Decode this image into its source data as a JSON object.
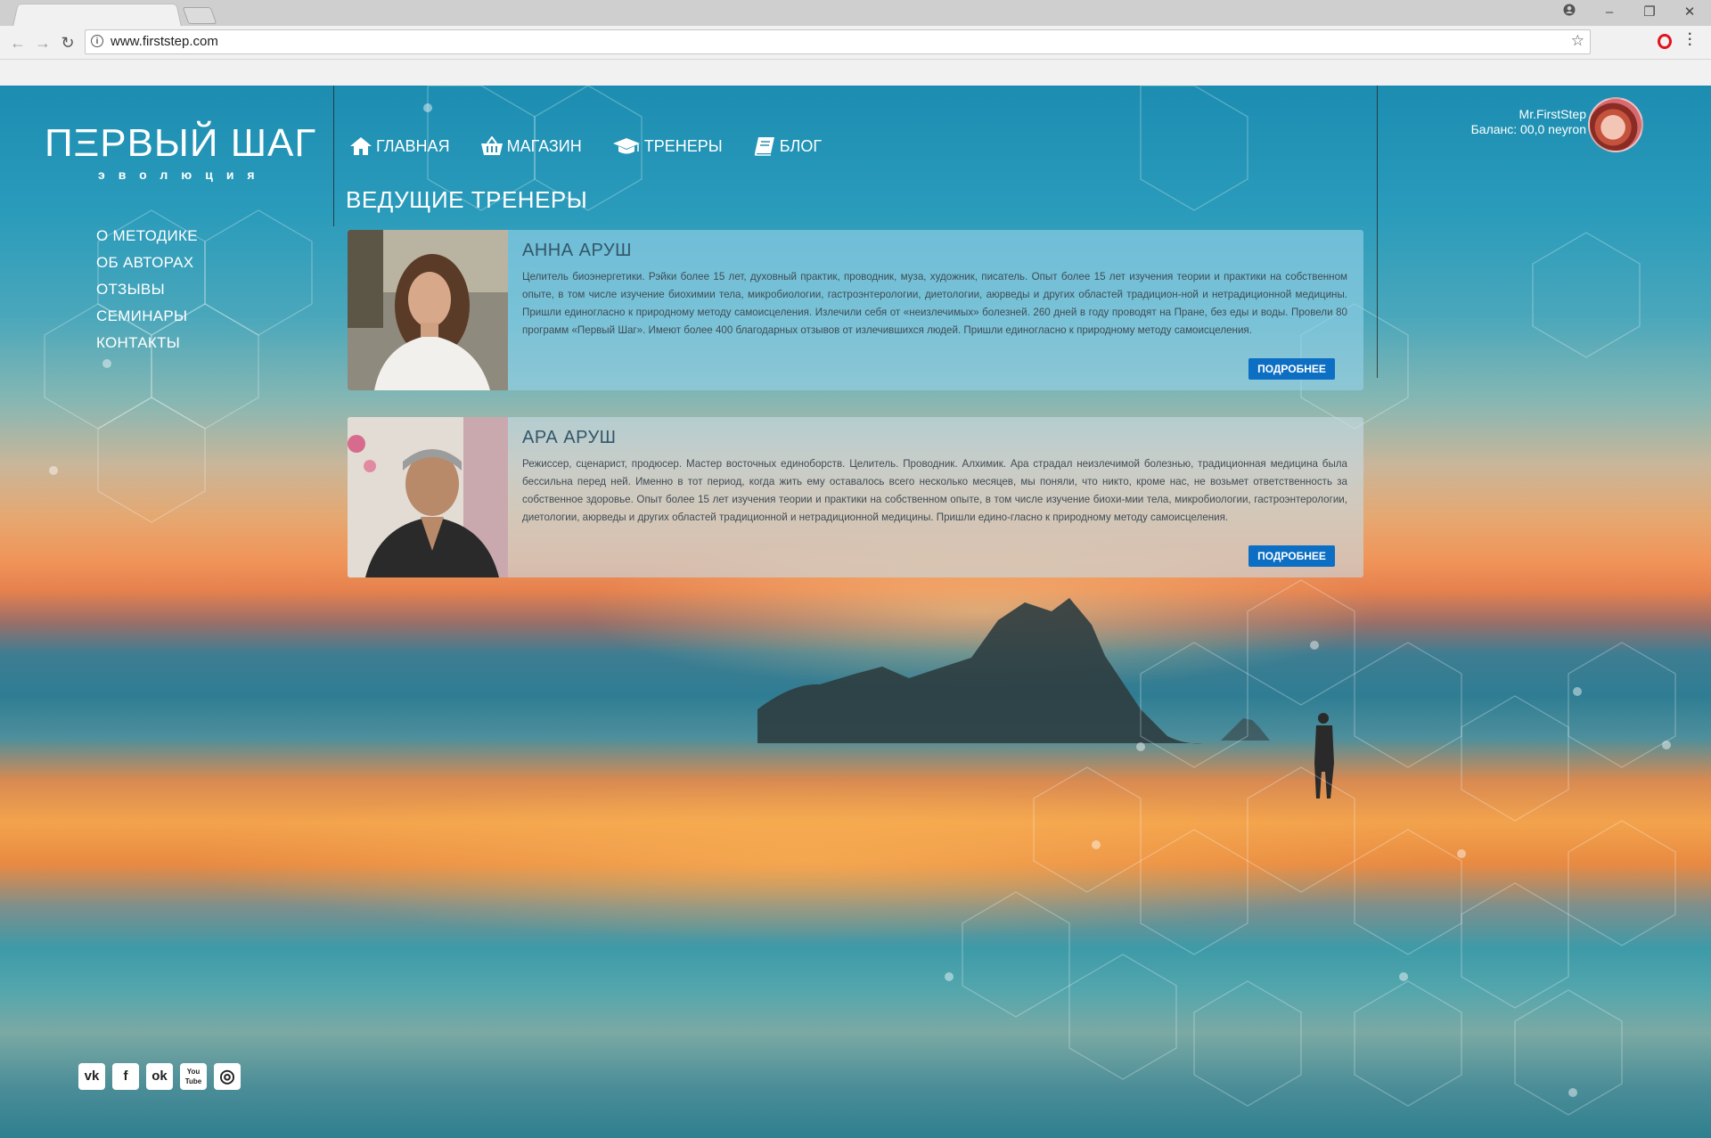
{
  "browser": {
    "url": "www.firststep.com",
    "window_controls": [
      "–",
      "❐",
      "✕"
    ]
  },
  "site": {
    "logo_title": "ПΞРВЫЙ ШАГ",
    "logo_subtitle": "эволюция",
    "topnav": [
      {
        "label": "ГЛАВНАЯ",
        "icon": "home-icon"
      },
      {
        "label": "МАГАЗИН",
        "icon": "basket-icon"
      },
      {
        "label": "ТРЕНЕРЫ",
        "icon": "graduation-cap-icon"
      },
      {
        "label": "БЛОГ",
        "icon": "book-icon"
      }
    ],
    "section_title": "ВЕДУЩИЕ ТРЕНЕРЫ",
    "sidenav": [
      "О МЕТОДИКЕ",
      "ОБ АВТОРАХ",
      "ОТЗЫВЫ",
      "СЕМИНАРЫ",
      "КОНТАКТЫ"
    ],
    "user": {
      "name": "Mr.FirstStep",
      "balance": "Баланс: 00,0 neyron"
    }
  },
  "trainers": [
    {
      "name": "АННА АРУШ",
      "text": "Целитель биоэнергетики. Рэйки более 15 лет, духовный практик, проводник, муза, художник, писатель. Опыт более 15 лет изучения теории и практики на собственном опыте, в том числе изучение биохимии тела, микробиологии, гастроэнтерологии, диетологии, аюрведы и других областей традицион-ной и нетрадиционной медицины. Пришли единогласно к природному методу самоисцеления. Излечили себя от «неизлечимых» болезней. 260 дней в году проводят на Пране, без еды и воды. Провели 80 программ «Первый Шаг». Имеют более 400 благодарных отзывов от излечившихся людей. Пришли единогласно к природному методу самоисцеления.",
      "button": "ПОДРОБНЕЕ"
    },
    {
      "name": "АРА АРУШ",
      "text": "Режиссер, сценарист, продюсер. Мастер восточных единоборств. Целитель. Проводник. Алхимик. Ара страдал неизлечимой болезнью, традиционная медицина была бессильна перед ней. Именно в тот период, когда жить ему оставалось всего несколько месяцев, мы поняли, что никто, кроме нас, не возьмет ответственность за собственное здоровье. Опыт более 15 лет изучения теории и практики на собственном опыте, в том числе изучение биохи-мии тела, микробиологии, гастроэнтерологии, диетологии, аюрведы и других областей традиционной и нетрадиционной медицины. Пришли едино-гласно к природному методу самоисцеления.",
      "button": "ПОДРОБНЕЕ"
    }
  ],
  "social": [
    {
      "label": "vk",
      "icon": "vk-icon"
    },
    {
      "label": "f",
      "icon": "facebook-icon"
    },
    {
      "label": "ok",
      "icon": "odnoklassniki-icon"
    },
    {
      "label": "You Tube",
      "icon": "youtube-icon"
    },
    {
      "label": "◎",
      "icon": "instagram-icon"
    }
  ]
}
